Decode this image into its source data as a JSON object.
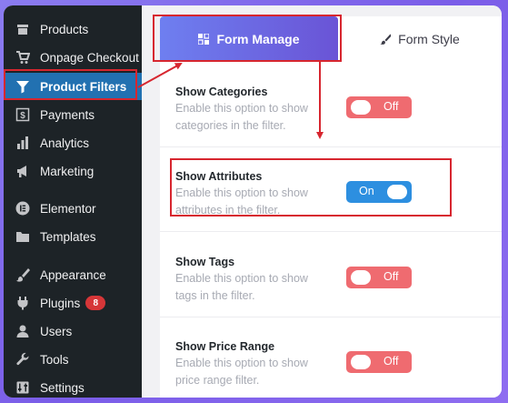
{
  "sidebar": {
    "items": [
      {
        "label": "Products",
        "icon": "products-icon"
      },
      {
        "label": "Onpage Checkout",
        "icon": "cart-icon"
      },
      {
        "label": "Product Filters",
        "icon": "filter-icon",
        "active": true
      },
      {
        "label": "Payments",
        "icon": "dollar-icon"
      },
      {
        "label": "Analytics",
        "icon": "chart-icon"
      },
      {
        "label": "Marketing",
        "icon": "megaphone-icon"
      },
      {
        "label": "Elementor",
        "icon": "elementor-icon"
      },
      {
        "label": "Templates",
        "icon": "folder-icon"
      },
      {
        "label": "Appearance",
        "icon": "brush-icon"
      },
      {
        "label": "Plugins",
        "icon": "plug-icon",
        "badge": "8"
      },
      {
        "label": "Users",
        "icon": "user-icon"
      },
      {
        "label": "Tools",
        "icon": "wrench-icon"
      },
      {
        "label": "Settings",
        "icon": "settings-icon"
      }
    ]
  },
  "tabs": {
    "form_manage": "Form Manage",
    "form_style": "Form Style"
  },
  "options": [
    {
      "title": "Show Categories",
      "description": "Enable this option to show categories in the filter.",
      "state": "Off"
    },
    {
      "title": "Show Attributes",
      "description": "Enable this option to show attributes in the filter.",
      "state": "On"
    },
    {
      "title": "Show Tags",
      "description": "Enable this option to show tags in the filter.",
      "state": "Off"
    },
    {
      "title": "Show Price Range",
      "description": "Enable this option to show price range filter.",
      "state": "Off"
    }
  ],
  "colors": {
    "sidebar_bg": "#1d2327",
    "active_item": "#2271b1",
    "toggle_off": "#ef6b70",
    "toggle_on": "#2d8fe0",
    "annotation": "#d7262f"
  }
}
